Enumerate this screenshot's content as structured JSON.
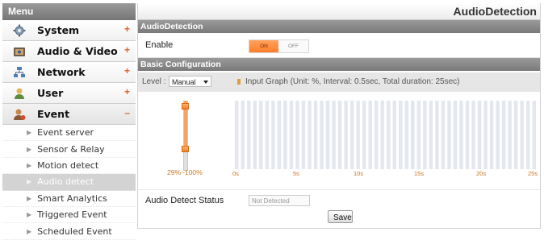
{
  "sidebar": {
    "header": "Menu",
    "items": [
      {
        "label": "System",
        "sign": "+",
        "icon": "system-icon"
      },
      {
        "label": "Audio & Video",
        "sign": "+",
        "icon": "audio-video-icon"
      },
      {
        "label": "Network",
        "sign": "+",
        "icon": "network-icon"
      },
      {
        "label": "User",
        "sign": "+",
        "icon": "user-icon"
      },
      {
        "label": "Event",
        "sign": "–",
        "icon": "event-icon"
      }
    ],
    "sub_items": [
      {
        "label": "Event server"
      },
      {
        "label": "Sensor & Relay"
      },
      {
        "label": "Motion detect"
      },
      {
        "label": "Audio detect",
        "selected": true
      },
      {
        "label": "Smart Analytics"
      },
      {
        "label": "Triggered Event"
      },
      {
        "label": "Scheduled Event"
      }
    ]
  },
  "page": {
    "title": "AudioDetection",
    "section1": "AudioDetection",
    "enable_label": "Enable",
    "toggle": {
      "on": "ON",
      "off": "OFF",
      "state": "on"
    },
    "section2": "Basic Configuration",
    "level_label": "Level :",
    "level_value": "Manual",
    "graph_title": "Input Graph (Unit: %, Interval: 0.5sec, Total duration: 25sec)",
    "range_text": "29%~100%",
    "threshold": {
      "low": 29,
      "high": 100
    },
    "x_ticks": [
      "0s",
      "5s",
      "10s",
      "15s",
      "20s",
      "25s"
    ],
    "status_label": "Audio Detect Status",
    "status_value": "Not Detected",
    "save_label": "Save",
    "colors": {
      "accent": "#ff8a3a",
      "header": "#8a8a8a",
      "graph_bar": "#e4e8ee"
    }
  }
}
